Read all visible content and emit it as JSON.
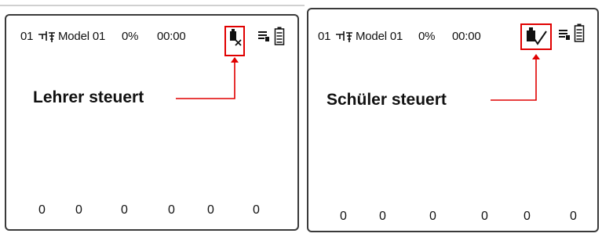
{
  "screens": [
    {
      "model_number": "01",
      "model_name": "Model 01",
      "throttle_pct": "0%",
      "timer": "00:00",
      "trainer_icon": "trainer-crossed-icon",
      "caption": "Lehrer steuert",
      "channel_values": [
        "0",
        "0",
        "0",
        "0",
        "0",
        "0"
      ]
    },
    {
      "model_number": "01",
      "model_name": "Model 01",
      "throttle_pct": "0%",
      "timer": "00:00",
      "trainer_icon": "trainer-check-icon",
      "caption": "Schüler steuert",
      "channel_values": [
        "0",
        "0",
        "0",
        "0",
        "0",
        "0"
      ]
    }
  ],
  "colors": {
    "highlight": "#e00000",
    "border": "#3a3a3a"
  },
  "icons": [
    "antenna-icon",
    "trainer-crossed-icon",
    "trainer-check-icon",
    "menu-list-icon",
    "battery-icon"
  ]
}
